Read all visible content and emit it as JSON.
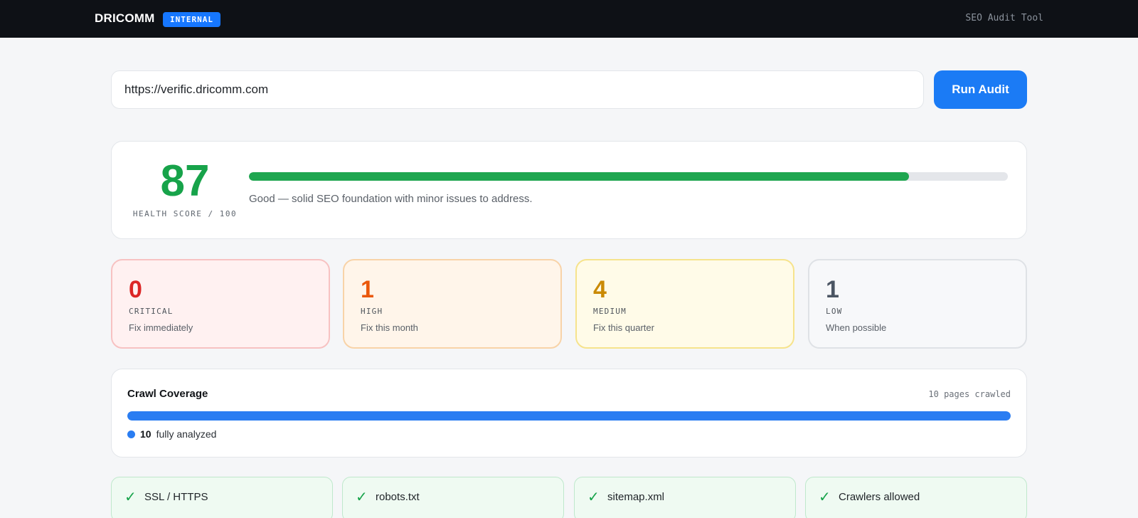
{
  "header": {
    "logo": "DRICOMM",
    "badge": "INTERNAL",
    "tool_name": "SEO Audit Tool"
  },
  "audit_form": {
    "url_value": "https://verific.dricomm.com",
    "run_label": "Run Audit"
  },
  "health": {
    "score": "87",
    "label": "HEALTH SCORE / 100",
    "progress_fraction": 0.87,
    "description": "Good — solid SEO foundation with minor issues to address.",
    "color": "#17a34a"
  },
  "severity": [
    {
      "count": "0",
      "label": "CRITICAL",
      "sub": "Fix immediately",
      "color": "#dc2626"
    },
    {
      "count": "1",
      "label": "HIGH",
      "sub": "Fix this month",
      "color": "#ea580c"
    },
    {
      "count": "4",
      "label": "MEDIUM",
      "sub": "Fix this quarter",
      "color": "#ca8a04"
    },
    {
      "count": "1",
      "label": "LOW",
      "sub": "When possible",
      "color": "#4b5563"
    }
  ],
  "crawl": {
    "title": "Crawl Coverage",
    "meta": "10 pages crawled",
    "analyzed_fraction": 1.0,
    "legend_count": "10",
    "legend_label": "fully analyzed",
    "color": "#2a7df2"
  },
  "checks": [
    {
      "icon": "check-icon",
      "label": "SSL / HTTPS"
    },
    {
      "icon": "check-icon",
      "label": "robots.txt"
    },
    {
      "icon": "check-icon",
      "label": "sitemap.xml"
    },
    {
      "icon": "check-icon",
      "label": "Crawlers allowed"
    }
  ]
}
